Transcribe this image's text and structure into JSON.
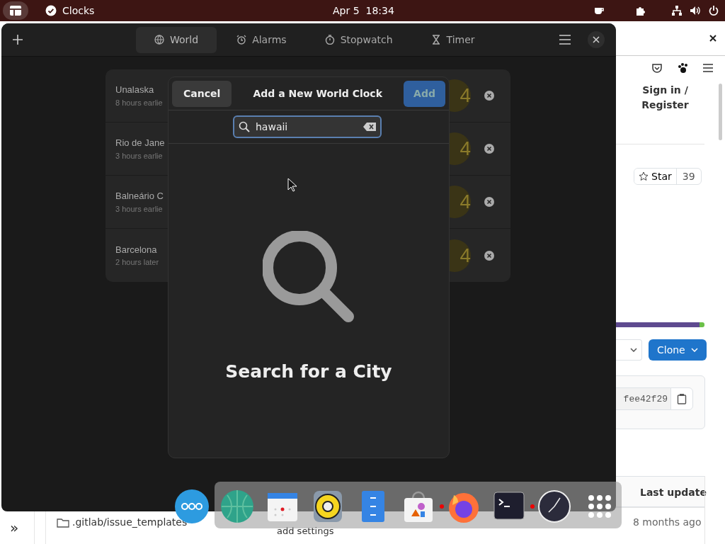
{
  "top_bar": {
    "app_name": "Clocks",
    "clock": "Apr 5  18:34"
  },
  "clocks_window": {
    "tabs": [
      {
        "label": "World",
        "kind": "globe",
        "selected": true
      },
      {
        "label": "Alarms",
        "kind": "alarm",
        "selected": false
      },
      {
        "label": "Stopwatch",
        "kind": "stopwatch",
        "selected": false
      },
      {
        "label": "Timer",
        "kind": "timer",
        "selected": false
      }
    ],
    "cities": [
      {
        "name": "Unalaska",
        "offset": "8 hours earlie",
        "time": "4"
      },
      {
        "name": "Rio de Jane",
        "offset": "3 hours earlie",
        "time": "4"
      },
      {
        "name": "Balneário C",
        "offset": "3 hours earlie",
        "time": "4"
      },
      {
        "name": "Barcelona",
        "offset": "2 hours later",
        "time": "4"
      }
    ]
  },
  "dialog": {
    "cancel": "Cancel",
    "title": "Add a New World Clock",
    "add": {
      "label": "Add",
      "disabled": true
    },
    "search": {
      "value": "hawaii"
    },
    "empty_title": "Search for a City"
  },
  "browser": {
    "sidebar_toggle": "»",
    "progress": {
      "level": 0.94
    },
    "sign_in": "Sign in / Register",
    "star": "Star",
    "star_count": "39",
    "clone": "Clone",
    "commit_hash": "fee42f29",
    "table_header": "Last update",
    "rows": [
      {
        "name": ".gitlab/issue_templates",
        "updated": "8 months ago"
      }
    ],
    "hidden_text": "add settings"
  },
  "dock": [
    {
      "kind": "dots",
      "running": false
    },
    {
      "kind": "globe",
      "running": false
    },
    {
      "kind": "calendar",
      "running": false
    },
    {
      "kind": "speaker",
      "running": false
    },
    {
      "kind": "cabinet",
      "running": false
    },
    {
      "kind": "bag",
      "running": false
    },
    {
      "kind": "fox",
      "running": true
    },
    {
      "kind": "terminal",
      "running": false
    },
    {
      "kind": "clock",
      "running": true
    },
    {
      "kind": "grid",
      "running": false
    }
  ]
}
